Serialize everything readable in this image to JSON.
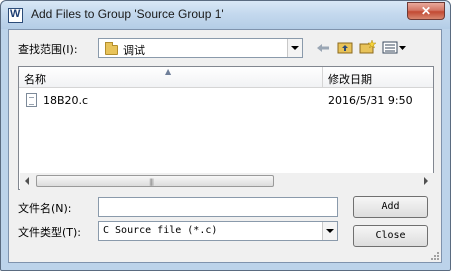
{
  "window": {
    "title": "Add Files to Group 'Source Group 1'",
    "close_glyph": "✕"
  },
  "lookin": {
    "label": "查找范围(I):",
    "value": "调试"
  },
  "toolbar": {
    "back_icon": "back-arrow-icon",
    "up_icon": "up-folder-icon",
    "new_icon": "new-folder-icon",
    "view_icon": "view-menu-icon"
  },
  "list": {
    "columns": [
      "名称",
      "修改日期"
    ],
    "rows": [
      {
        "name": "18B20.c",
        "modified": "2016/5/31 9:50"
      }
    ]
  },
  "filename": {
    "label": "文件名(N):",
    "value": ""
  },
  "filetype": {
    "label": "文件类型(T):",
    "value": "C Source file (*.c)"
  },
  "buttons": {
    "add": "Add",
    "close": "Close"
  }
}
